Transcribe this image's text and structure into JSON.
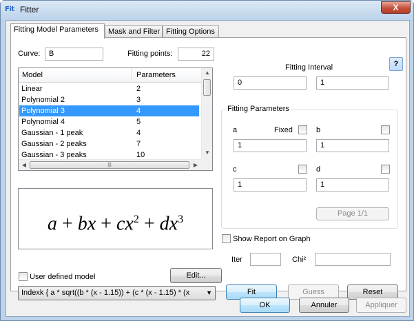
{
  "window": {
    "title": "Fitter",
    "app_icon": "Fit",
    "close_symbol": "X"
  },
  "tabs": [
    {
      "label": "Fitting Model  Parameters",
      "active": true
    },
    {
      "label": "Mask and Filter",
      "active": false
    },
    {
      "label": "Fitting Options",
      "active": false
    }
  ],
  "curve": {
    "label": "Curve:",
    "value": "B"
  },
  "fitting_points": {
    "label": "Fitting points:",
    "value": "22"
  },
  "model_list": {
    "columns": [
      "Model",
      "Parameters"
    ],
    "rows": [
      {
        "model": "Linear",
        "params": "2"
      },
      {
        "model": "Polynomial 2",
        "params": "3"
      },
      {
        "model": "Polynomial 3",
        "params": "4",
        "selected": true
      },
      {
        "model": "Polynomial 4",
        "params": "5"
      },
      {
        "model": "Gaussian - 1 peak",
        "params": "4"
      },
      {
        "model": "Gaussian - 2 peaks",
        "params": "7"
      },
      {
        "model": "Gaussian - 3 peaks",
        "params": "10"
      }
    ]
  },
  "formula": {
    "a": "a",
    "plus": "+",
    "b": "b",
    "x": "x",
    "c": "c",
    "d": "d",
    "exp2": "2",
    "exp3": "3"
  },
  "user_defined": {
    "label": "User defined model",
    "checked": false
  },
  "edit_button": "Edit...",
  "expression_combo": "Indexk { a * sqrt((b * (x - 1.15)) + (c * (x - 1.15) * (x",
  "help_button": "?",
  "fitting_interval": {
    "label": "Fitting Interval",
    "from": "0",
    "to": "1"
  },
  "fitting_parameters": {
    "title": "Fitting Parameters",
    "fixed_label": "Fixed",
    "params": [
      {
        "name": "a",
        "value": "1",
        "fixed": false
      },
      {
        "name": "b",
        "value": "1",
        "fixed": false
      },
      {
        "name": "c",
        "value": "1",
        "fixed": false
      },
      {
        "name": "d",
        "value": "1",
        "fixed": false
      }
    ],
    "page_button": "Page 1/1"
  },
  "show_report": {
    "label": "Show Report on Graph",
    "checked": false
  },
  "iter": {
    "label": "Iter",
    "value": ""
  },
  "chi": {
    "label": "Chi²",
    "value": ""
  },
  "actions": {
    "fit": "Fit",
    "guess": "Guess",
    "reset": "Reset"
  },
  "dialog_buttons": {
    "ok": "OK",
    "cancel": "Annuler",
    "apply": "Appliquer"
  }
}
